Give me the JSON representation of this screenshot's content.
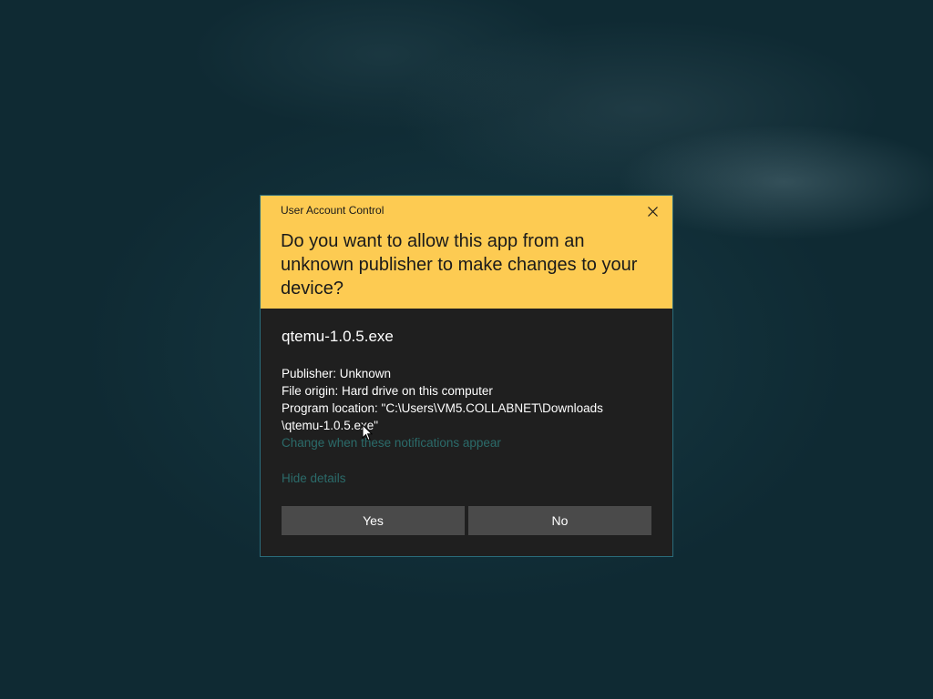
{
  "dialog": {
    "title": "User Account Control",
    "question": "Do you want to allow this app from an unknown publisher to make changes to your device?",
    "app_name": "qtemu-1.0.5.exe",
    "publisher": "Publisher: Unknown",
    "file_origin": "File origin: Hard drive on this computer",
    "program_location_line1": "Program location: \"C:\\Users\\VM5.COLLABNET\\Downloads",
    "program_location_line2": "\\qtemu-1.0.5.exe\"",
    "change_link": "Change when these notifications appear",
    "hide_details": "Hide details",
    "yes_label": "Yes",
    "no_label": "No"
  },
  "colors": {
    "header_bg": "#fdcb52",
    "body_bg": "#1f1f1f",
    "button_bg": "#4a4a4a",
    "link": "#2b6b6a"
  },
  "icons": {
    "close": "close-icon",
    "cursor": "mouse-pointer-icon"
  }
}
